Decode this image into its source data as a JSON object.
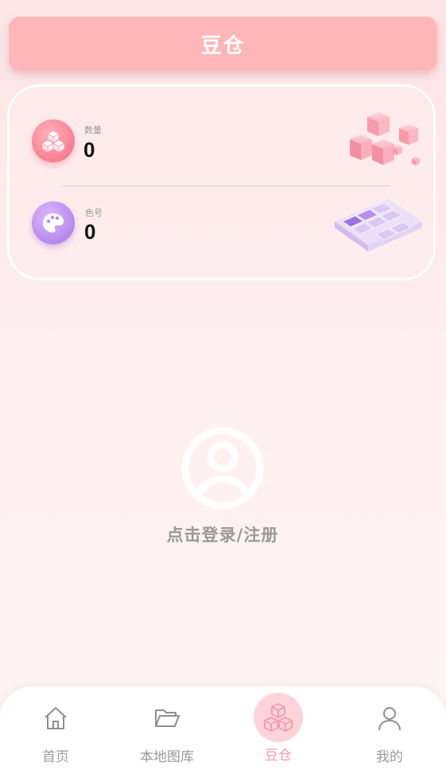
{
  "header": {
    "title": "豆仓"
  },
  "stats": {
    "count": {
      "label": "数量",
      "value": "0"
    },
    "colors": {
      "label": "色号",
      "value": "0"
    }
  },
  "login": {
    "text": "点击登录/注册"
  },
  "tabbar": {
    "items": [
      {
        "label": "首页",
        "icon": "home-icon"
      },
      {
        "label": "本地图库",
        "icon": "folder-icon"
      },
      {
        "label": "豆仓",
        "icon": "cubes-icon",
        "active": true
      },
      {
        "label": "我的",
        "icon": "user-icon"
      }
    ]
  },
  "colors": {
    "header": "#ffb6b9",
    "active_tab": "#f29bab",
    "background": "#fde4e6"
  }
}
